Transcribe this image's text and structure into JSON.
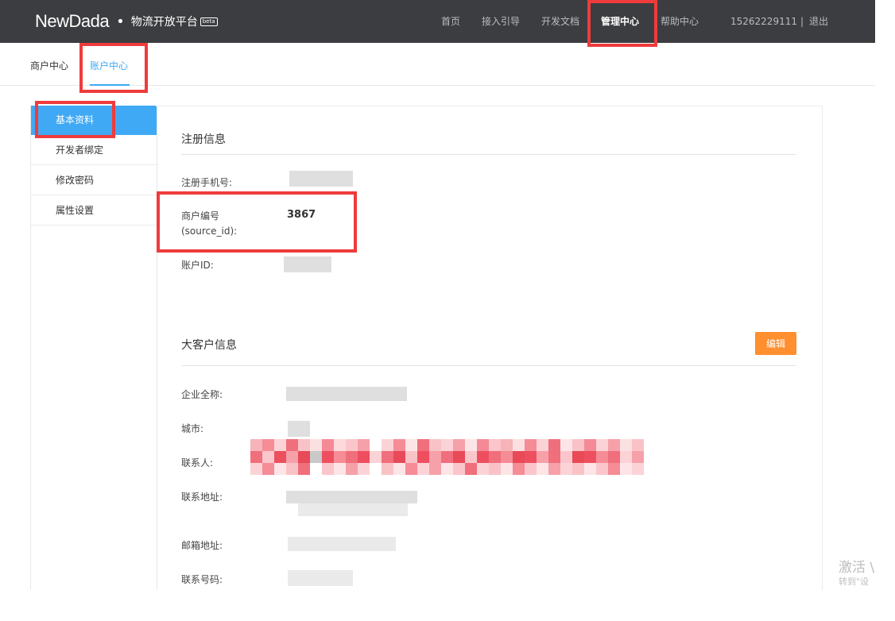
{
  "header": {
    "brand": "NewDada",
    "dot": "•",
    "platform": "物流开放平台",
    "beta": "beta",
    "nav": [
      "首页",
      "接入引导",
      "开发文档",
      "管理中心",
      "帮助中心"
    ],
    "active_nav": "管理中心",
    "user_phone": "15262229111",
    "separator": "|",
    "logout": "退出"
  },
  "subnav": {
    "tabs": [
      "商户中心",
      "账户中心"
    ],
    "active": "账户中心"
  },
  "sidebar": {
    "items": [
      "基本资料",
      "开发者绑定",
      "修改密码",
      "属性设置"
    ],
    "active": "基本资料"
  },
  "registration": {
    "title": "注册信息",
    "phone_label": "注册手机号:",
    "merchant_label_line1": "商户编号",
    "merchant_label_line2": "(source_id):",
    "merchant_value": "3867",
    "account_label": "账户ID:"
  },
  "enterprise": {
    "title": "大客户信息",
    "edit_label": "编辑",
    "company_label": "企业全称:",
    "city_label": "城市:",
    "contact_label": "联系人:",
    "address_label": "联系地址:",
    "email_label": "邮箱地址:",
    "phone_label": "联系号码:"
  },
  "watermark": {
    "line1": "激活 \\",
    "line2": "转到\"设"
  },
  "colors": {
    "topbar": "#3c3d40",
    "accent": "#3fa9f5",
    "edit_button": "#ff8f2f",
    "annotation": "#ef3b3b"
  }
}
